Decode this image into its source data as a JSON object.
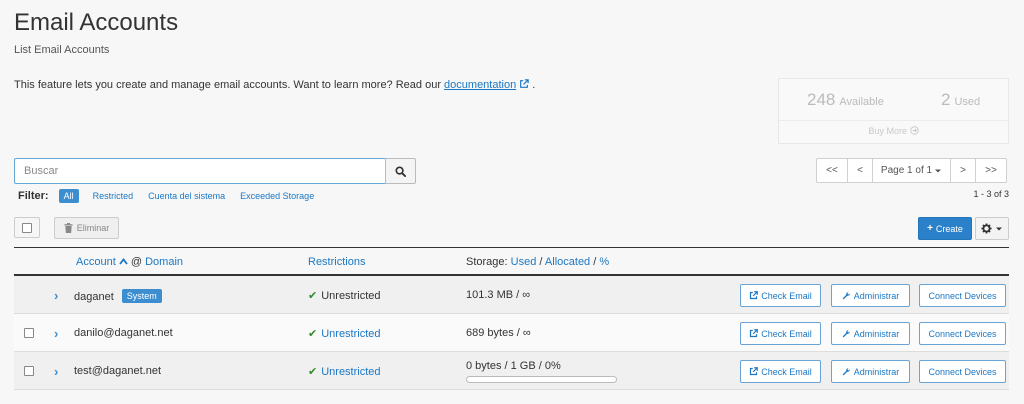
{
  "header": {
    "title": "Email Accounts",
    "subtitle": "List Email Accounts",
    "intro_text": "This feature lets you create and manage email accounts. Want to learn more? Read our ",
    "doc_link": "documentation",
    "intro_end": "."
  },
  "stats": {
    "available_count": "248",
    "available_label": "Available",
    "used_count": "2",
    "used_label": "Used",
    "buy_more": "Buy More"
  },
  "search": {
    "placeholder": "Buscar",
    "value": ""
  },
  "pagination": {
    "first": "<<",
    "prev": "<",
    "page_label": "Page 1 of 1",
    "next": ">",
    "last": ">>",
    "result_count": "1 - 3 of 3"
  },
  "filter": {
    "label": "Filter:",
    "options": [
      "All",
      "Restricted",
      "Cuenta del sistema",
      "Exceeded Storage"
    ]
  },
  "actions": {
    "delete_label": "Eliminar",
    "create_label": "Create"
  },
  "table": {
    "headers": {
      "account": "Account",
      "at_domain": "@",
      "domain": "Domain",
      "restrictions": "Restrictions",
      "storage": "Storage:",
      "used": "Used",
      "allocated": "Allocated",
      "percent": "%",
      "slash": "/"
    },
    "rows": [
      {
        "account": "daganet",
        "badge": "System",
        "restriction": "Unrestricted",
        "storage": "101.3 MB / ∞",
        "usage_fraction": null
      },
      {
        "account": "danilo@daganet.net",
        "badge": "",
        "restriction": "Unrestricted",
        "storage": "689 bytes / ∞",
        "usage_fraction": null
      },
      {
        "account": "test@daganet.net",
        "badge": "",
        "restriction": "Unrestricted",
        "storage": "0 bytes / 1 GB / 0%",
        "usage_fraction": 0
      }
    ],
    "row_buttons": {
      "check_email": "Check Email",
      "manage": "Administrar",
      "connect": "Connect Devices"
    }
  },
  "colors": {
    "primary": "#2a80c9",
    "link": "#1b78c4",
    "success": "#2e8b2e"
  }
}
